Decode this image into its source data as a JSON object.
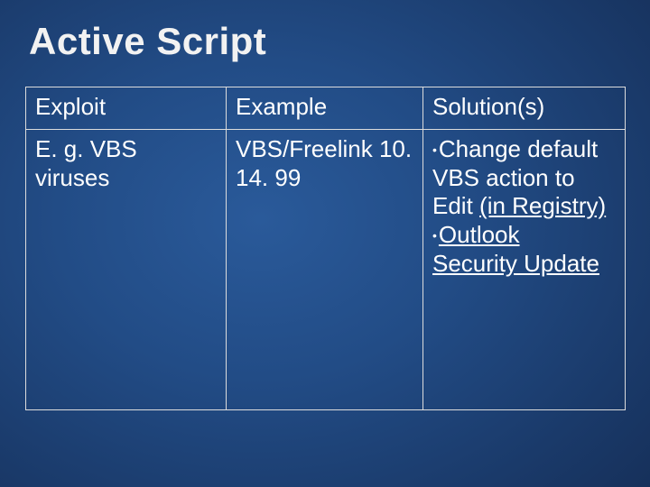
{
  "title": "Active Script",
  "table": {
    "headers": [
      "Exploit",
      "Example",
      "Solution(s)"
    ],
    "row": {
      "exploit": "E. g. VBS viruses",
      "example": "VBS/Freelink 10. 14. 99",
      "solutions": {
        "s1_text": "Change default VBS action to Edit ",
        "s1_link": "(in Registry)",
        "s2_link1": "Outlook",
        "s2_link2": "Security Update"
      }
    }
  }
}
